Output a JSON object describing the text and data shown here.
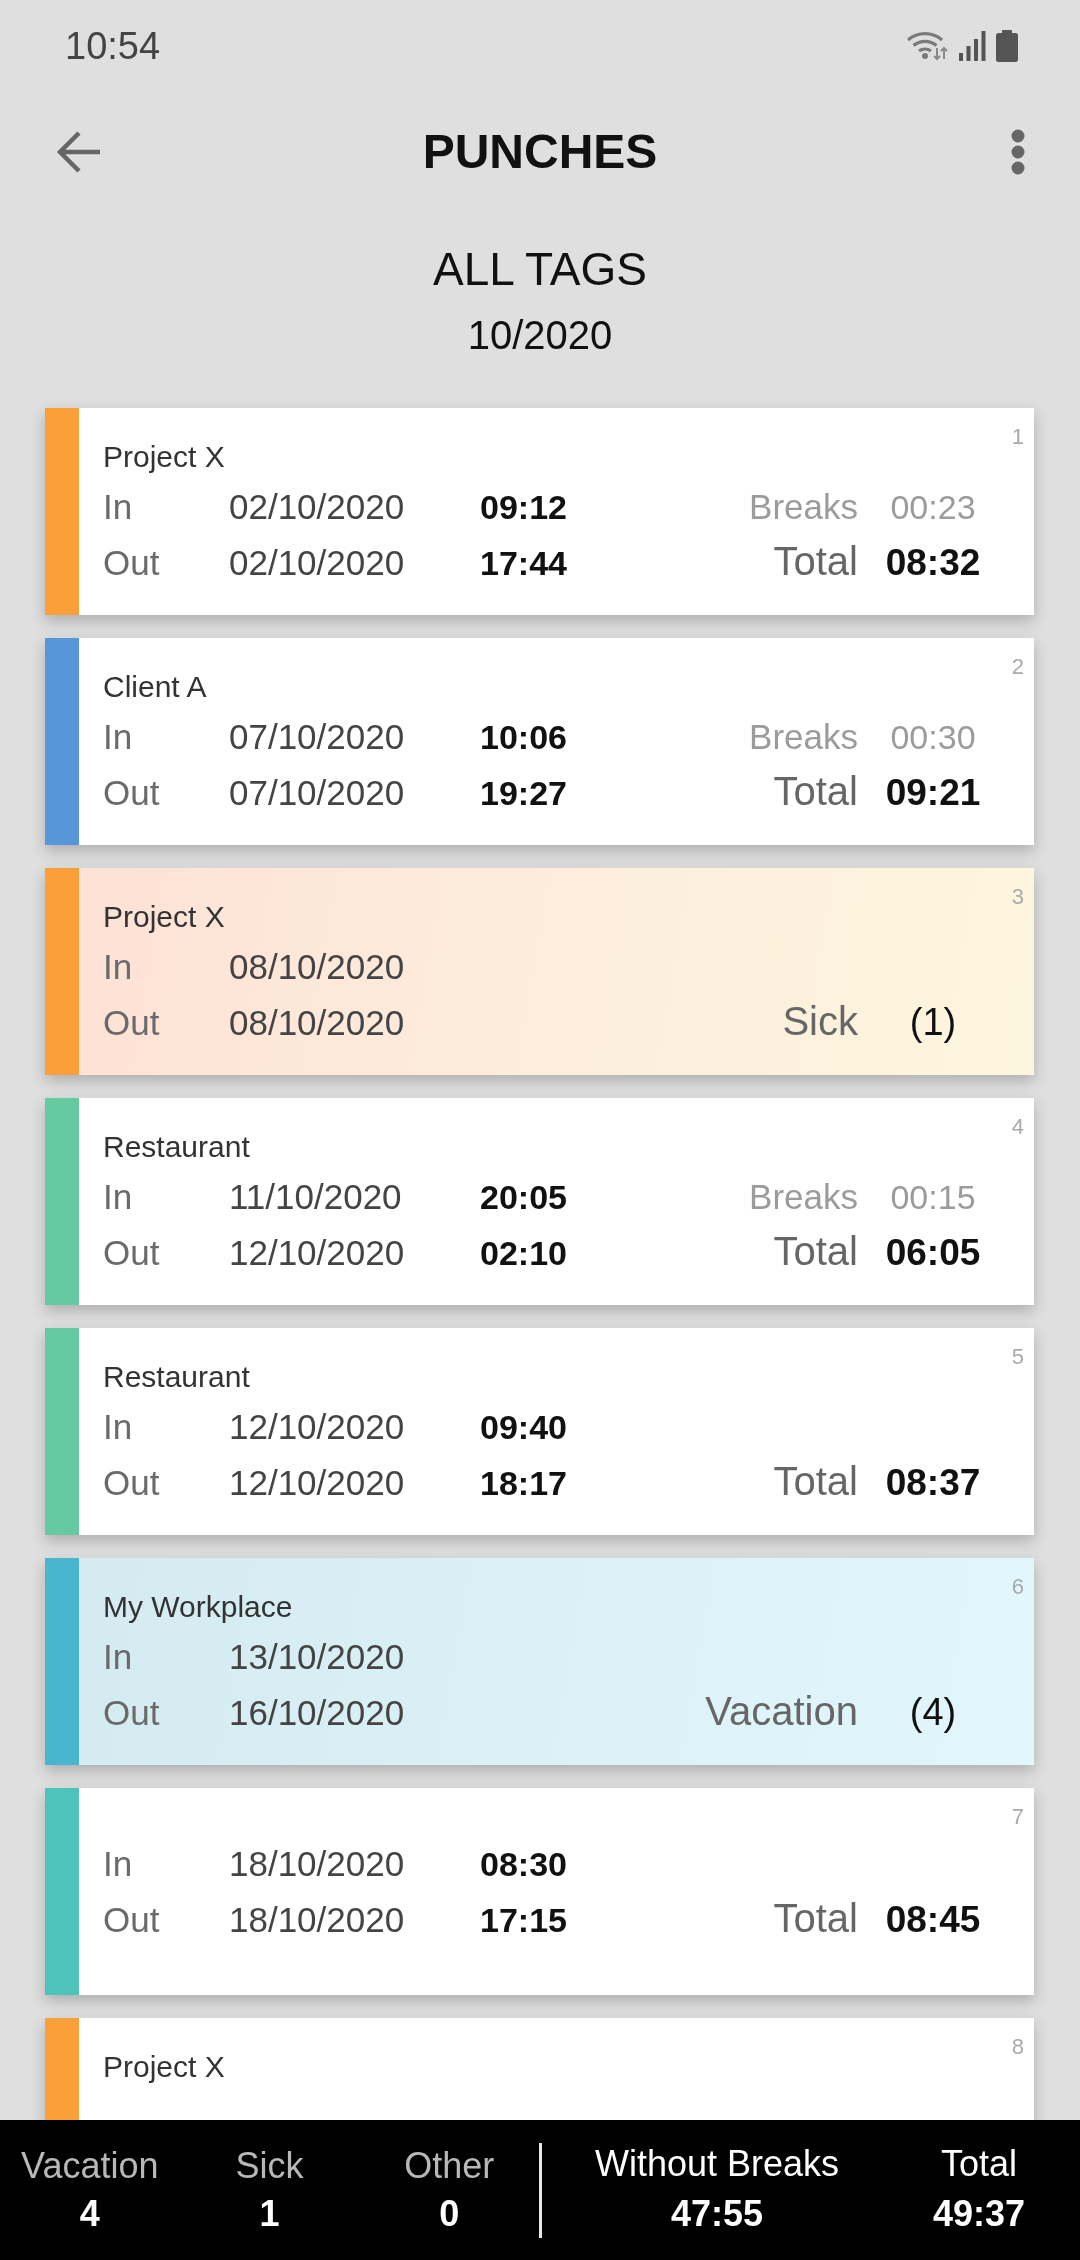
{
  "status_bar": {
    "time": "10:54"
  },
  "app_bar": {
    "title": "PUNCHES"
  },
  "header": {
    "tag": "ALL TAGS",
    "period": "10/2020"
  },
  "punches": [
    {
      "number": "1",
      "kind": "shift",
      "tag": "Project X",
      "color": "#faa03a",
      "rows": [
        {
          "label": "In",
          "date": "02/10/2020",
          "time": "09:12",
          "kind": "breaks",
          "side_label": "Breaks",
          "side_value": "00:23"
        },
        {
          "label": "Out",
          "date": "02/10/2020",
          "time": "17:44",
          "kind": "total",
          "side_label": "Total",
          "side_value": "08:32"
        }
      ]
    },
    {
      "number": "2",
      "kind": "shift",
      "tag": "Client A",
      "color": "#5896da",
      "rows": [
        {
          "label": "In",
          "date": "07/10/2020",
          "time": "10:06",
          "kind": "breaks",
          "side_label": "Breaks",
          "side_value": "00:30"
        },
        {
          "label": "Out",
          "date": "07/10/2020",
          "time": "19:27",
          "kind": "total",
          "side_label": "Total",
          "side_value": "09:21"
        }
      ]
    },
    {
      "number": "3",
      "kind": "sick",
      "tag": "Project X",
      "color": "#faa03a",
      "rows": [
        {
          "label": "In",
          "date": "08/10/2020"
        },
        {
          "label": "Out",
          "date": "08/10/2020",
          "kind": "absence",
          "side_label": "Sick",
          "side_value": "(1)"
        }
      ]
    },
    {
      "number": "4",
      "kind": "shift",
      "tag": "Restaurant",
      "color": "#66caa1",
      "rows": [
        {
          "label": "In",
          "date": "11/10/2020",
          "time": "20:05",
          "kind": "breaks",
          "side_label": "Breaks",
          "side_value": "00:15"
        },
        {
          "label": "Out",
          "date": "12/10/2020",
          "time": "02:10",
          "kind": "total",
          "side_label": "Total",
          "side_value": "06:05"
        }
      ]
    },
    {
      "number": "5",
      "kind": "shift",
      "tag": "Restaurant",
      "color": "#66caa1",
      "rows": [
        {
          "label": "In",
          "date": "12/10/2020",
          "time": "09:40"
        },
        {
          "label": "Out",
          "date": "12/10/2020",
          "time": "18:17",
          "kind": "total",
          "side_label": "Total",
          "side_value": "08:37"
        }
      ]
    },
    {
      "number": "6",
      "kind": "vacation",
      "tag": "My Workplace",
      "color": "#48b6cf",
      "rows": [
        {
          "label": "In",
          "date": "13/10/2020"
        },
        {
          "label": "Out",
          "date": "16/10/2020",
          "kind": "absence",
          "side_label": "Vacation",
          "side_value": "(4)"
        }
      ]
    },
    {
      "number": "7",
      "kind": "shift",
      "color": "#4cc4bc",
      "rows": [
        {
          "label": "In",
          "date": "18/10/2020",
          "time": "08:30"
        },
        {
          "label": "Out",
          "date": "18/10/2020",
          "time": "17:15",
          "kind": "total",
          "side_label": "Total",
          "side_value": "08:45"
        }
      ]
    },
    {
      "number": "8",
      "kind": "shift",
      "tag": "Project X",
      "color": "#faa03a"
    }
  ],
  "summary": {
    "counts": [
      {
        "label": "Vacation",
        "value": "4"
      },
      {
        "label": "Sick",
        "value": "1"
      },
      {
        "label": "Other",
        "value": "0"
      }
    ],
    "totals": [
      {
        "label": "Without Breaks",
        "value": "47:55"
      },
      {
        "label": "Total",
        "value": "49:37"
      }
    ]
  }
}
